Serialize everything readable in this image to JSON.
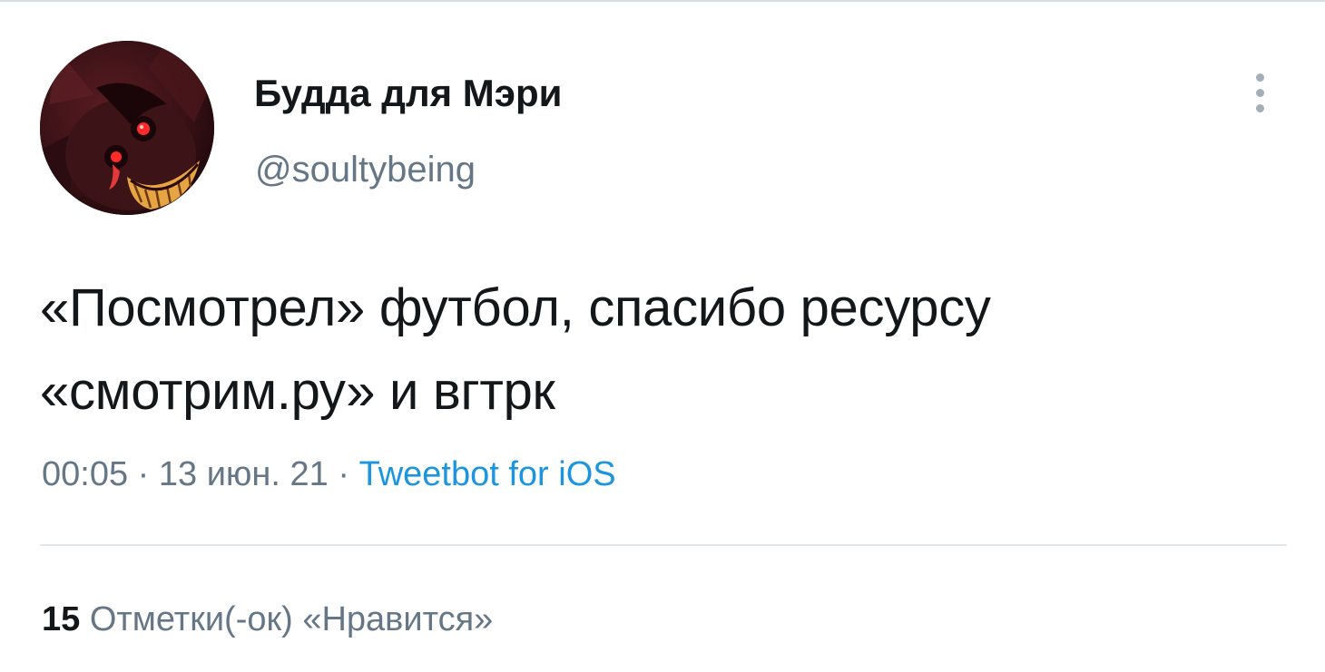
{
  "author": {
    "display_name": "Будда для Мэри",
    "handle": "@soultybeing",
    "avatar_icon": "cartoon-character-avatar"
  },
  "tweet": {
    "text_lines": [
      "«Посмотрел» футбол, спасибо ресурсу",
      "«смотрим.ру» и вгтрк"
    ],
    "time": "00:05",
    "separator": "·",
    "date": "13 июн. 21",
    "source": "Tweetbot for iOS"
  },
  "stats": {
    "likes_count": "15",
    "likes_label": "Отметки(-ок) «Нравится»"
  },
  "icons": {
    "more": "more-options-icon"
  },
  "colors": {
    "text_primary": "#14171a",
    "text_secondary": "#657786",
    "link": "#1b95e0",
    "divider": "#e1e6ea"
  }
}
